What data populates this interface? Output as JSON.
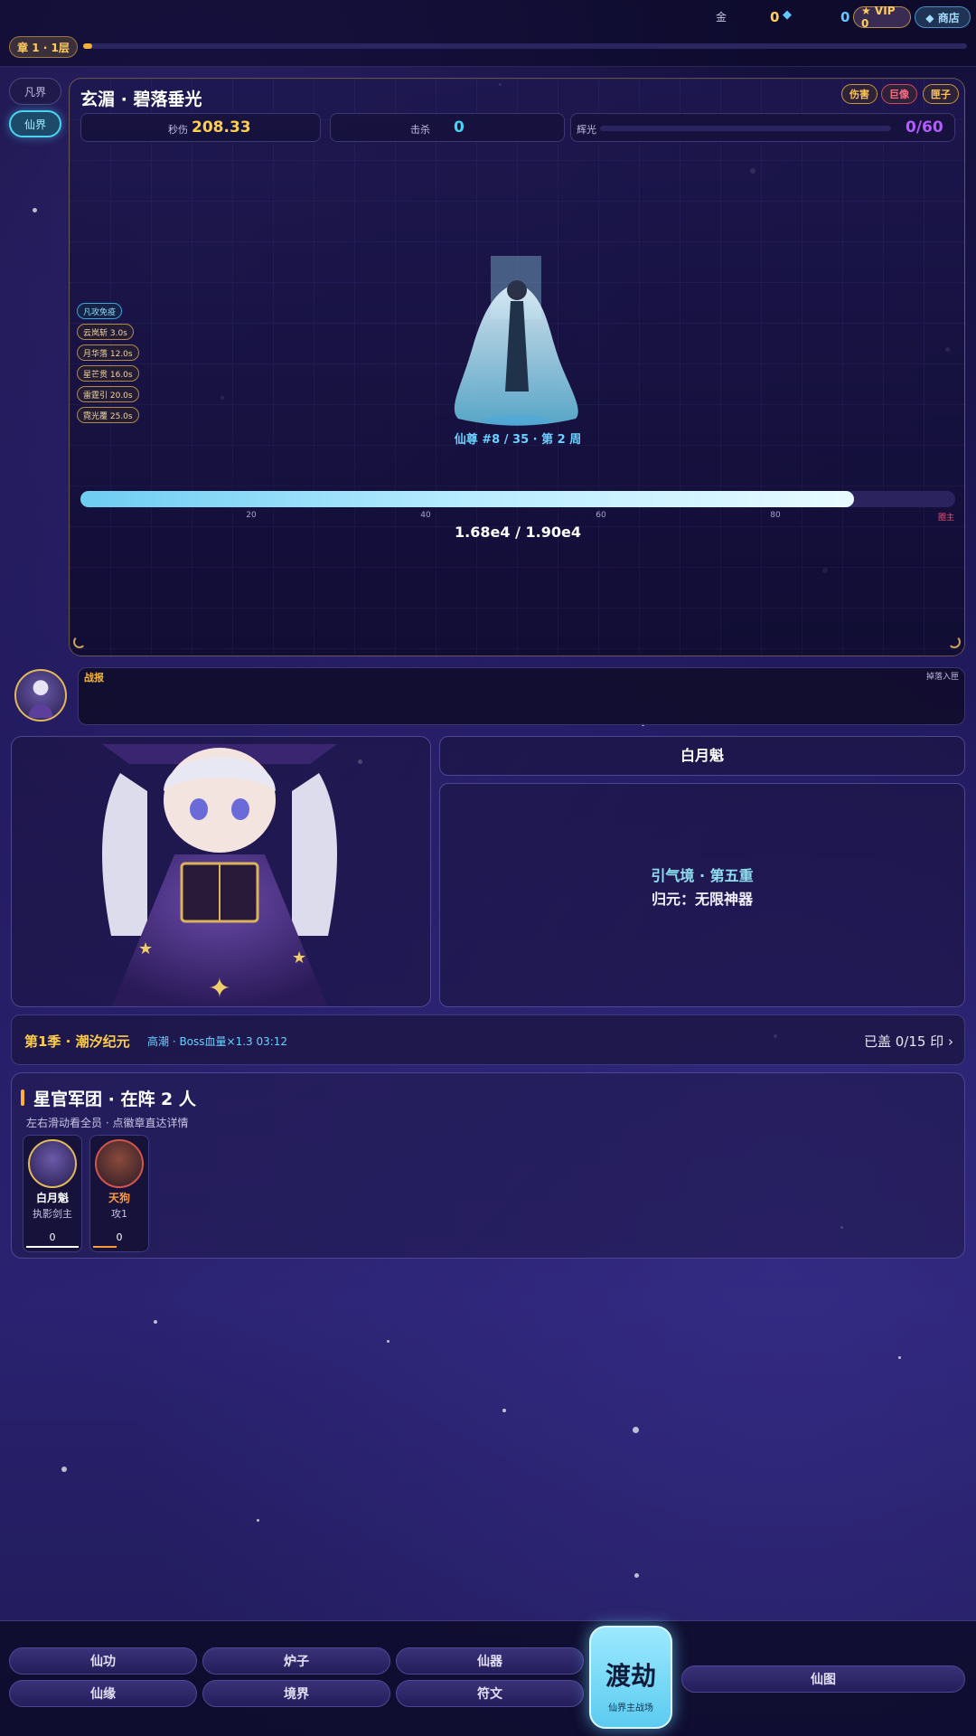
{
  "topbar": {
    "gold_label": "金",
    "gold_value": "0",
    "gem_value": "0",
    "vip_label": "★ VIP 0",
    "shop_label": "◆ 商店",
    "chapter_label": "章 1 · 1层",
    "chapter_progress": 0.01
  },
  "realm_tabs": [
    {
      "label": "凡界",
      "active": false
    },
    {
      "label": "仙界",
      "active": true
    }
  ],
  "battle": {
    "boss_name": "玄湄 · 碧落垂光",
    "tags": [
      "伤害",
      "巨像",
      "匣子"
    ],
    "dps_label": "秒伤",
    "dps_value": "208.33",
    "kills_label": "击杀",
    "kills_value": "0",
    "glow_label": "辉光",
    "glow_value": "0/60",
    "glow_progress": 0.0,
    "buffs": [
      "凡攻免疫",
      "云岚斩 3.0s",
      "月华落 12.0s",
      "星芒贯 16.0s",
      "雷霆引 20.0s",
      "霓光覆 25.0s"
    ],
    "boss_info": "仙尊 #8 / 35 · 第 2 周",
    "hp_ticks": [
      "20",
      "40",
      "60",
      "80",
      "圈主"
    ],
    "hp_fraction": 0.884,
    "hp_text": "1.68e4 / 1.90e4"
  },
  "report": {
    "title": "战报",
    "right_label": "掉落入匣"
  },
  "character": {
    "name": "白月魁",
    "realm": "引气境 · 第五重",
    "origin": "归元：无限神器"
  },
  "season": {
    "title": "第1季 · 潮汐纪元",
    "subtitle": "高潮 · Boss血量×1.3 03:12",
    "right": "已盖 0/15 印 ›"
  },
  "army": {
    "title": "星官军团 · 在阵 2 人",
    "subtitle": "左右滑动看全员 · 点徽章直达详情",
    "members": [
      {
        "name": "白月魁",
        "role": "执影剑主",
        "value": "0",
        "color": "#ffffff",
        "ring": "#e2b95a"
      },
      {
        "name": "天狗",
        "role": "攻1",
        "value": "0",
        "color": "#ff9a3a",
        "ring": "#d2554c"
      }
    ]
  },
  "nav": {
    "buttons": [
      "仙功",
      "炉子",
      "仙器",
      "仙缘",
      "境界",
      "符文"
    ],
    "main_label": "渡劫",
    "main_sub": "仙界主战场",
    "map_label": "仙图"
  },
  "colors": {
    "accent_gold": "#ffcf5a",
    "accent_cyan": "#4ad3f0",
    "hp_bar": "#b7ecff",
    "glow_value": "#b35cff"
  }
}
